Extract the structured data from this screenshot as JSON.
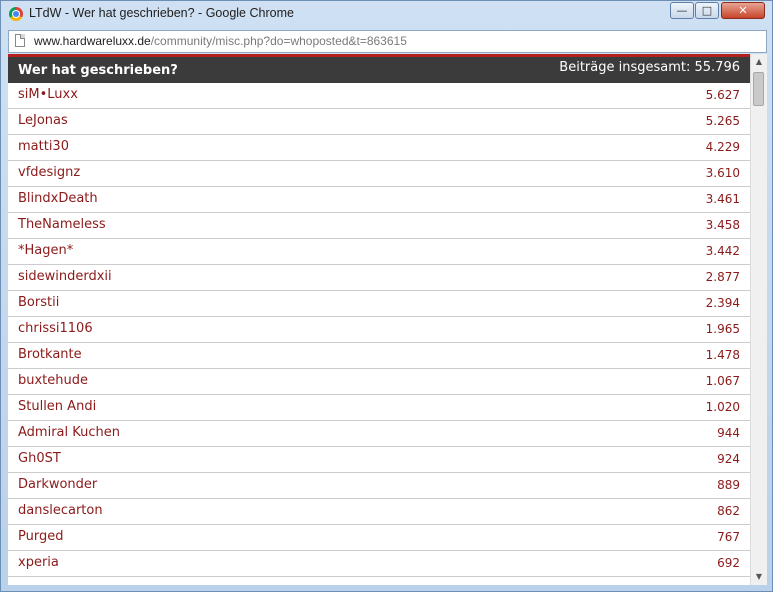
{
  "window": {
    "title": "LTdW - Wer hat geschrieben? - Google Chrome",
    "minimize_label": "—",
    "maximize_label": "□",
    "close_label": "✕"
  },
  "address": {
    "host": "www.hardwareluxx.de",
    "path": "/community/misc.php?do=whoposted&t=863615"
  },
  "panel": {
    "title": "Wer hat geschrieben?",
    "total_label": "Beiträge insgesamt: 55.796"
  },
  "posters": [
    {
      "name": "siM•Luxx",
      "count": "5.627"
    },
    {
      "name": "LeJonas",
      "count": "5.265"
    },
    {
      "name": "matti30",
      "count": "4.229"
    },
    {
      "name": "vfdesignz",
      "count": "3.610"
    },
    {
      "name": "BlindxDeath",
      "count": "3.461"
    },
    {
      "name": "TheNameless",
      "count": "3.458"
    },
    {
      "name": "*Hagen*",
      "count": "3.442"
    },
    {
      "name": "sidewinderdxii",
      "count": "2.877"
    },
    {
      "name": "Borstii",
      "count": "2.394"
    },
    {
      "name": "chrissi1106",
      "count": "1.965"
    },
    {
      "name": "Brotkante",
      "count": "1.478"
    },
    {
      "name": "buxtehude",
      "count": "1.067"
    },
    {
      "name": "Stullen Andi",
      "count": "1.020"
    },
    {
      "name": "Admiral Kuchen",
      "count": "944"
    },
    {
      "name": "Gh0ST",
      "count": "924"
    },
    {
      "name": "Darkwonder",
      "count": "889"
    },
    {
      "name": "danslecarton",
      "count": "862"
    },
    {
      "name": "Purged",
      "count": "767"
    },
    {
      "name": "xperia",
      "count": "692"
    }
  ],
  "scrollbar": {
    "up_label": "▲",
    "down_label": "▼"
  },
  "colors": {
    "header_bg": "#3b3b3b",
    "header_accent": "#b3201e",
    "link": "#8b1a1a"
  }
}
